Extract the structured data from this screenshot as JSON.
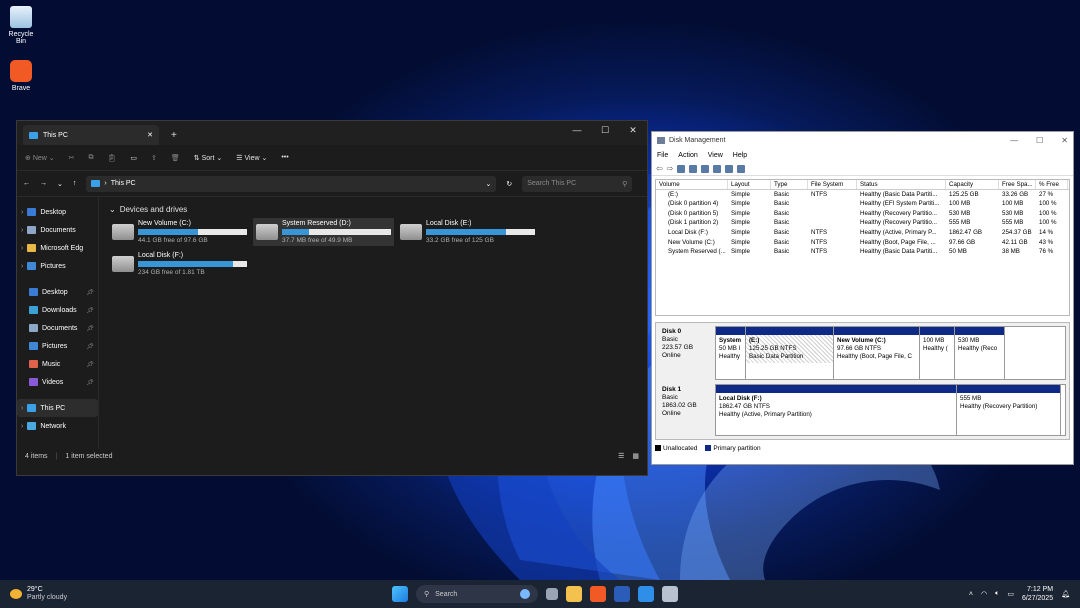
{
  "desktop": {
    "icons": [
      {
        "label": "Recycle Bin",
        "color": "#9cc2e0"
      },
      {
        "label": "Brave",
        "color": "#f15a24"
      }
    ]
  },
  "explorer": {
    "tab_title": "This PC",
    "toolbar": {
      "new": "New",
      "sort": "Sort",
      "view": "View"
    },
    "address": "This PC",
    "search_placeholder": "Search This PC",
    "nav": {
      "tree": [
        {
          "label": "Desktop",
          "color": "#3a7bd5"
        },
        {
          "label": "Documents",
          "color": "#8ea7c8"
        },
        {
          "label": "Microsoft Edg",
          "color": "#e8b84a"
        },
        {
          "label": "Pictures",
          "color": "#3f88d8"
        }
      ],
      "quick": [
        {
          "label": "Desktop",
          "color": "#3a7bd5"
        },
        {
          "label": "Downloads",
          "color": "#3aa0d5"
        },
        {
          "label": "Documents",
          "color": "#8ea7c8"
        },
        {
          "label": "Pictures",
          "color": "#3f88d8"
        },
        {
          "label": "Music",
          "color": "#e0624a"
        },
        {
          "label": "Videos",
          "color": "#8a5ad8"
        }
      ],
      "this_pc": "This PC",
      "network": "Network"
    },
    "section_title": "Devices and drives",
    "drives": [
      {
        "name": "New Volume (C:)",
        "free": "44.1 GB free of 97.6 GB",
        "used_fraction": 0.55
      },
      {
        "name": "System Reserved (D:)",
        "free": "37.7 MB free of 49.9 MB",
        "used_fraction": 0.25
      },
      {
        "name": "Local Disk (E:)",
        "free": "33.2 GB free of 125 GB",
        "used_fraction": 0.73
      },
      {
        "name": "Local Disk (F:)",
        "free": "234 GB free of 1.81 TB",
        "used_fraction": 0.87
      }
    ],
    "status": {
      "items": "4 items",
      "selected": "1 item selected"
    }
  },
  "disk_management": {
    "title": "Disk Management",
    "menu": [
      "File",
      "Action",
      "View",
      "Help"
    ],
    "columns": [
      "Volume",
      "Layout",
      "Type",
      "File System",
      "Status",
      "Capacity",
      "Free Spa...",
      "% Free"
    ],
    "volumes": [
      [
        "(E:)",
        "Simple",
        "Basic",
        "NTFS",
        "Healthy (Basic Data Partiti...",
        "125.25 GB",
        "33.26 GB",
        "27 %"
      ],
      [
        "(Disk 0 partition 4)",
        "Simple",
        "Basic",
        "",
        "Healthy (EFI System Partiti...",
        "100 MB",
        "100 MB",
        "100 %"
      ],
      [
        "(Disk 0 partition 5)",
        "Simple",
        "Basic",
        "",
        "Healthy (Recovery Partitio...",
        "530 MB",
        "530 MB",
        "100 %"
      ],
      [
        "(Disk 1 partition 2)",
        "Simple",
        "Basic",
        "",
        "Healthy (Recovery Partitio...",
        "555 MB",
        "555 MB",
        "100 %"
      ],
      [
        "Local Disk (F:)",
        "Simple",
        "Basic",
        "NTFS",
        "Healthy (Active, Primary P...",
        "1862.47 GB",
        "254.37 GB",
        "14 %"
      ],
      [
        "New Volume (C:)",
        "Simple",
        "Basic",
        "NTFS",
        "Healthy (Boot, Page File, ...",
        "97.66 GB",
        "42.11 GB",
        "43 %"
      ],
      [
        "System Reserved (...",
        "Simple",
        "Basic",
        "NTFS",
        "Healthy (Basic Data Partiti...",
        "50 MB",
        "38 MB",
        "76 %"
      ]
    ],
    "disks": [
      {
        "name": "Disk 0",
        "type": "Basic",
        "size": "223.57 GB",
        "state": "Online",
        "partitions": [
          {
            "title": "System",
            "size": "50 MB I",
            "status": "Healthy",
            "w": 30
          },
          {
            "title": "(E:)",
            "size": "125.25 GB NTFS",
            "status": "Basic Data Partition",
            "w": 88,
            "selected": true
          },
          {
            "title": "New Volume  (C:)",
            "size": "97.66 GB NTFS",
            "status": "Healthy (Boot, Page File, C",
            "w": 86
          },
          {
            "title": "",
            "size": "100 MB",
            "status": "Healthy (",
            "w": 35
          },
          {
            "title": "",
            "size": "530 MB",
            "status": "Healthy (Reco",
            "w": 50
          }
        ]
      },
      {
        "name": "Disk 1",
        "type": "Basic",
        "size": "1863.02 GB",
        "state": "Online",
        "partitions": [
          {
            "title": "Local Disk  (F:)",
            "size": "1862.47 GB NTFS",
            "status": "Healthy (Active, Primary Partition)",
            "w": 241
          },
          {
            "title": "",
            "size": "555 MB",
            "status": "Healthy (Recovery Partition)",
            "w": 104
          }
        ]
      }
    ],
    "legend": [
      {
        "label": "Unallocated",
        "color": "#000000"
      },
      {
        "label": "Primary partition",
        "color": "#0e2a86"
      }
    ]
  },
  "taskbar": {
    "temperature": "29°C",
    "weather": "Partly cloudy",
    "search": "Search",
    "time": "7:12 PM",
    "date": "6/27/2025"
  }
}
